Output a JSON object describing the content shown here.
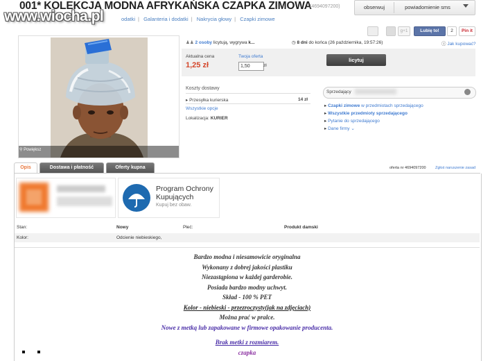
{
  "header": {
    "title": "001* KOLEKCJA MODNA AFRYKAŃSKA CZAPKA ZIMOWA",
    "offer_id": "(4694097200)",
    "watermark": "www.wiocha.pl",
    "breadcrumb": [
      "odatki",
      "Galanteria i dodatki",
      "Nakrycia głowy",
      "Czapki zimowe"
    ],
    "observe_label": "obserwuj",
    "sms_label": "powiadomienie sms"
  },
  "social": {
    "gplus": "g+1",
    "like": "Lubię to!",
    "like_count": "2",
    "pin": "Pin it"
  },
  "gallery": {
    "zoom_label": "Powiększ"
  },
  "auction": {
    "bidders_count": "2 osoby",
    "bidders_text": "licytują, wygrywa",
    "winner": "k...",
    "time_left_bold": "8 dni",
    "time_left_text": "do końca (26 października, 19:57:26)",
    "how_to_buy": "Jak kupować?",
    "current_price_label": "Aktualna cena",
    "current_price": "1,25 zł",
    "your_offer_label": "Twoja oferta",
    "your_offer_value": "1,50",
    "currency": "zł",
    "bid_button": "licytuj"
  },
  "shipping": {
    "title": "Koszty dostawy",
    "method": "Przesyłka kurierska",
    "price": "14 zł",
    "all_options": "Wszystkie opcje",
    "location_label": "Lokalizacja:",
    "location_value": "KURIER"
  },
  "seller": {
    "label": "Sprzedający",
    "links": [
      {
        "bold": "Czapki zimowe",
        "rest": " w przedmiotach sprzedającego"
      },
      {
        "bold": "Wszystkie przedmioty sprzedającego",
        "rest": ""
      },
      {
        "bold": "",
        "rest": "Pytanie do sprzedającego"
      },
      {
        "bold": "",
        "rest": "Dane firmy"
      }
    ]
  },
  "tabs": [
    "Opis",
    "Dostawa i płatność",
    "Oferty kupna"
  ],
  "offer_nr": "oferta nr 4694097200",
  "report_link": "Zgłoś naruszenie zasad",
  "protection": {
    "title_line1": "Program Ochrony",
    "title_line2": "Kupujących",
    "subtitle": "Kupuj bez obaw."
  },
  "attributes": {
    "row1": {
      "label1": "Stan:",
      "value1": "Nowy",
      "label2": "Płeć:",
      "value2": "Produkt damski"
    },
    "row2": {
      "label1": "Kolor:",
      "value1": "Odcienie niebieskiego,"
    }
  },
  "description": {
    "lines": [
      "Bardzo modna i niesamowicie oryginalna",
      "Wykonany z dobrej jakości plastiku",
      "Niezastąpiona w każdej garderobie.",
      "Posiada bardzo modny uchwyt.",
      "Skład - 100 % PET"
    ],
    "color_line": "Kolor - niebieski - przezroczysty(jak na zdjęciach)",
    "wash_line": "Można prać w pralce.",
    "new_line": "Nowe z metką lub zapakowane w firmowe opakowanie producenta.",
    "no_tag_line": "Brak metki z rozmiarem.",
    "last_word": "czapka"
  },
  "colors": {
    "accent": "#d4462a",
    "link": "#3e7ad0",
    "tab_active": "#e8783e",
    "purple": "#4b2fa8"
  }
}
